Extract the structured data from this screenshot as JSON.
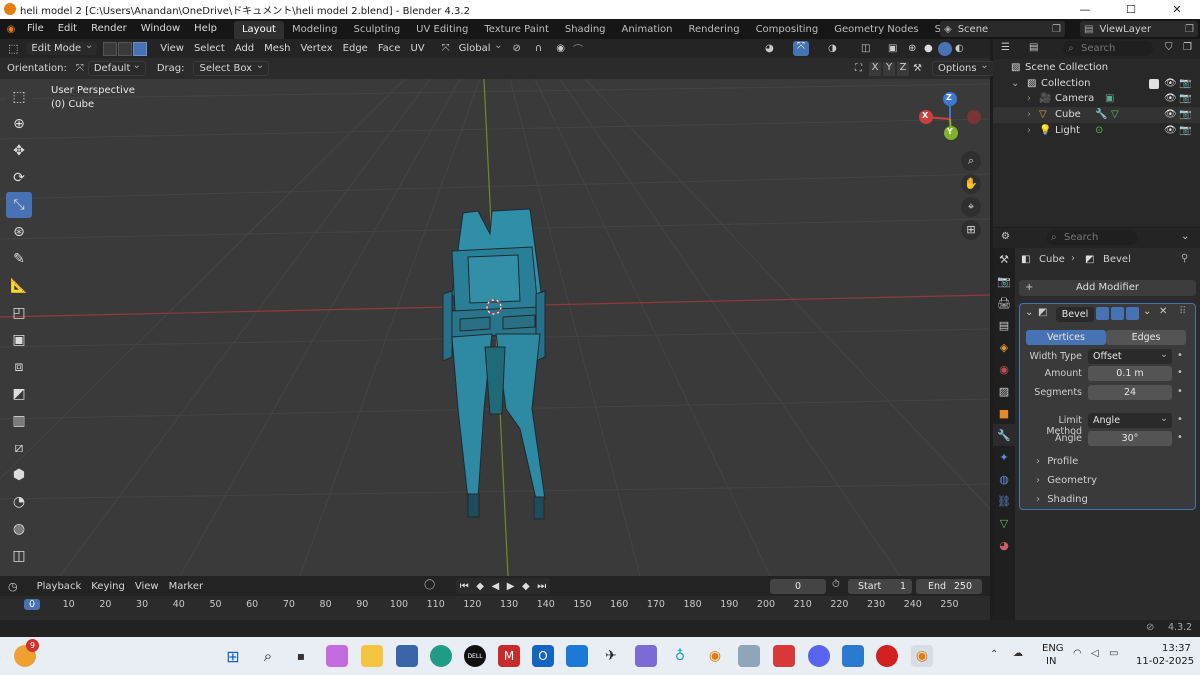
{
  "window": {
    "title": "heli model 2 [C:\\Users\\Anandan\\OneDrive\\ドキュメント\\heli model 2.blend] - Blender 4.3.2"
  },
  "menubar": {
    "menus": [
      "File",
      "Edit",
      "Render",
      "Window",
      "Help"
    ],
    "workspaces": [
      "Layout",
      "Modeling",
      "Sculpting",
      "UV Editing",
      "Texture Paint",
      "Shading",
      "Animation",
      "Rendering",
      "Compositing",
      "Geometry Nodes",
      "Scripting"
    ],
    "active_workspace": "Layout",
    "add_workspace": "+",
    "scene_label": "Scene",
    "viewlayer_label": "ViewLayer"
  },
  "viewport_header": {
    "mode": "Edit Mode",
    "menus": [
      "View",
      "Select",
      "Add",
      "Mesh",
      "Vertex",
      "Edge",
      "Face",
      "UV"
    ],
    "transform_orientation": "Global"
  },
  "viewport_subheader": {
    "orientation_label": "Orientation:",
    "orientation_value": "Default",
    "drag_label": "Drag:",
    "drag_value": "Select Box",
    "axes": [
      "X",
      "Y",
      "Z"
    ],
    "options": "Options"
  },
  "viewport": {
    "view_name": "User Perspective",
    "object_name": "(0) Cube",
    "gizmo_axes": [
      "X",
      "Y",
      "Z"
    ]
  },
  "timeline": {
    "menus": [
      "Playback",
      "Keying",
      "View",
      "Marker"
    ],
    "current_frame": "0",
    "start_label": "Start",
    "start_value": "1",
    "end_label": "End",
    "end_value": "250",
    "ticks": [
      "0",
      "10",
      "20",
      "30",
      "40",
      "50",
      "60",
      "70",
      "80",
      "90",
      "100",
      "110",
      "120",
      "130",
      "140",
      "150",
      "160",
      "170",
      "180",
      "190",
      "200",
      "210",
      "220",
      "230",
      "240",
      "250"
    ]
  },
  "outliner": {
    "search_placeholder": "Search",
    "scene_collection": "Scene Collection",
    "collection": "Collection",
    "items": [
      "Camera",
      "Cube",
      "Light"
    ]
  },
  "properties": {
    "search_placeholder": "Search",
    "breadcrumb_object": "Cube",
    "breadcrumb_modifier": "Bevel",
    "add_modifier": "Add Modifier",
    "modifier_name": "Bevel",
    "affect_tabs": [
      "Vertices",
      "Edges"
    ],
    "active_affect": "Vertices",
    "width_type_label": "Width Type",
    "width_type_value": "Offset",
    "amount_label": "Amount",
    "amount_value": "0.1 m",
    "segments_label": "Segments",
    "segments_value": "24",
    "limit_method_label": "Limit Method",
    "limit_method_value": "Angle",
    "angle_label": "Angle",
    "angle_value": "30°",
    "subpanels": [
      "Profile",
      "Geometry",
      "Shading"
    ]
  },
  "statusbar": {
    "version": "4.3.2"
  },
  "taskbar": {
    "weather_badge": "9",
    "language_primary": "ENG",
    "language_secondary": "IN",
    "time": "13:37",
    "date": "11-02-2025"
  },
  "colors": {
    "accent": "#4772b3",
    "mesh_face": "#2f8ea8",
    "x_axis": "#c8413f",
    "y_axis": "#7fb22a",
    "z_axis": "#3d78d6"
  }
}
